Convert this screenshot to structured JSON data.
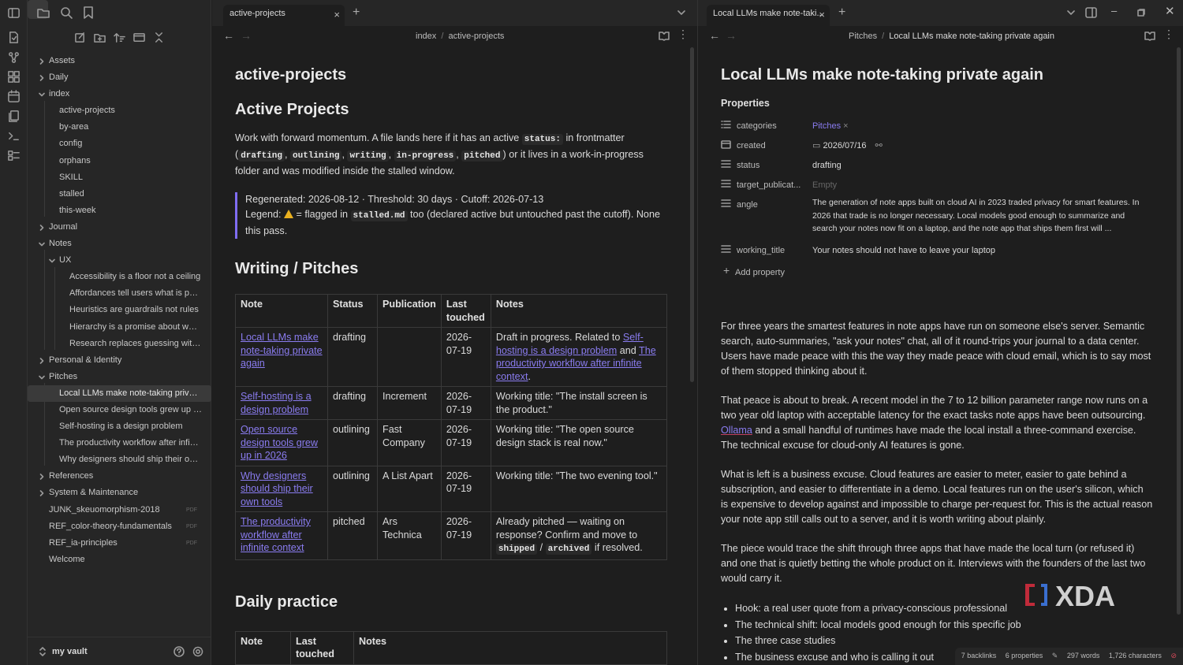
{
  "sidebar": {
    "tree": [
      {
        "label": "Assets",
        "type": "folder",
        "level": 0,
        "open": false
      },
      {
        "label": "Daily",
        "type": "folder",
        "level": 0,
        "open": false
      },
      {
        "label": "index",
        "type": "folder",
        "level": 0,
        "open": true
      },
      {
        "label": "active-projects",
        "type": "file",
        "level": 1
      },
      {
        "label": "by-area",
        "type": "file",
        "level": 1
      },
      {
        "label": "config",
        "type": "file",
        "level": 1
      },
      {
        "label": "orphans",
        "type": "file",
        "level": 1
      },
      {
        "label": "SKILL",
        "type": "file",
        "level": 1
      },
      {
        "label": "stalled",
        "type": "file",
        "level": 1
      },
      {
        "label": "this-week",
        "type": "file",
        "level": 1
      },
      {
        "label": "Journal",
        "type": "folder",
        "level": 0,
        "open": false
      },
      {
        "label": "Notes",
        "type": "folder",
        "level": 0,
        "open": true
      },
      {
        "label": "UX",
        "type": "folder",
        "level": 1,
        "open": true
      },
      {
        "label": "Accessibility is a floor not a ceiling",
        "type": "file",
        "level": 2
      },
      {
        "label": "Affordances tell users what is possi...",
        "type": "file",
        "level": 2
      },
      {
        "label": "Heuristics are guardrails not rules",
        "type": "file",
        "level": 2
      },
      {
        "label": "Hierarchy is a promise about what ...",
        "type": "file",
        "level": 2
      },
      {
        "label": "Research replaces guessing with wi...",
        "type": "file",
        "level": 2
      },
      {
        "label": "Personal & Identity",
        "type": "folder",
        "level": 0,
        "open": false
      },
      {
        "label": "Pitches",
        "type": "folder",
        "level": 0,
        "open": true
      },
      {
        "label": "Local LLMs make note-taking private ...",
        "type": "file",
        "level": 1,
        "active": true
      },
      {
        "label": "Open source design tools grew up in ...",
        "type": "file",
        "level": 1
      },
      {
        "label": "Self-hosting is a design problem",
        "type": "file",
        "level": 1
      },
      {
        "label": "The productivity workflow after infinit...",
        "type": "file",
        "level": 1
      },
      {
        "label": "Why designers should ship their own ...",
        "type": "file",
        "level": 1
      },
      {
        "label": "References",
        "type": "folder",
        "level": 0,
        "open": false
      },
      {
        "label": "System & Maintenance",
        "type": "folder",
        "level": 0,
        "open": false
      },
      {
        "label": "JUNK_skeuomorphism-2018",
        "type": "file",
        "level": 0,
        "badge": "PDF"
      },
      {
        "label": "REF_color-theory-fundamentals",
        "type": "file",
        "level": 0,
        "badge": "PDF"
      },
      {
        "label": "REF_ia-principles",
        "type": "file",
        "level": 0,
        "badge": "PDF"
      },
      {
        "label": "Welcome",
        "type": "file",
        "level": 0
      }
    ],
    "vault_name": "my vault"
  },
  "left": {
    "tab_label": "active-projects",
    "crumb_parent": "index",
    "crumb_sep": "/",
    "crumb_current": "active-projects",
    "h1": "active-projects",
    "h_active": "Active Projects",
    "intro": {
      "t1": "Work with forward momentum. A file lands here if it has an active ",
      "code_status": "status:",
      "t2": " in frontmatter (",
      "c_drafting": "drafting",
      "c_outlining": "outlining",
      "c_writing": "writing",
      "c_inprogress": "in-progress",
      "c_pitched": "pitched",
      "comma": ",",
      "t3": ") or it lives in a work-in-progress folder and was modified inside the stalled window."
    },
    "quote": {
      "line1": "Regenerated: 2026-08-12 · Threshold: 30 days · Cutoff: 2026-07-13",
      "legend_pre": "Legend: ",
      "legend_mid": " = flagged in ",
      "legend_code": "stalled.md",
      "legend_post": " too (declared active but untouched past the cutoff). None this pass."
    },
    "h_writing": "Writing / Pitches",
    "table_headers": [
      "Note",
      "Status",
      "Publication",
      "Last touched",
      "Notes"
    ],
    "rows": [
      {
        "note": "Local LLMs make note-taking private again",
        "status": "drafting",
        "pub": "",
        "date": "2026-07-19"
      },
      {
        "note": "Self-hosting is a design problem",
        "status": "drafting",
        "pub": "Increment",
        "date": "2026-07-19",
        "notes": "Working title: \"The install screen is the product.\""
      },
      {
        "note": "Open source design tools grew up in 2026",
        "status": "outlining",
        "pub": "Fast Company",
        "date": "2026-07-19",
        "notes": "Working title: \"The open source design stack is real now.\""
      },
      {
        "note": "Why designers should ship their own tools",
        "status": "outlining",
        "pub": "A List Apart",
        "date": "2026-07-19",
        "notes": "Working title: \"The two evening tool.\""
      },
      {
        "note": "The productivity workflow after infinite context",
        "status": "pitched",
        "pub": "Ars Technica",
        "date": "2026-07-19"
      }
    ],
    "row1_notes": {
      "t1": "Draft in progress. Related to ",
      "l1": "Self-hosting is a design problem",
      "t2": " and ",
      "l2": "The productivity workflow after infinite context",
      "t3": "."
    },
    "row5_notes": {
      "t1": "Already pitched — waiting on response? Confirm and move to ",
      "c1": "shipped",
      "sep": " / ",
      "c2": "archived",
      "t2": " if resolved."
    },
    "h_daily": "Daily practice",
    "daily_headers": [
      "Note",
      "Last touched",
      "Notes"
    ]
  },
  "right": {
    "tab_label": "Local LLMs make note-taki...",
    "crumb_parent": "Pitches",
    "crumb_sep": "/",
    "crumb_current": "Local LLMs make note-taking private again",
    "title": "Local LLMs make note-taking private again",
    "properties_label": "Properties",
    "props": {
      "categories_key": "categories",
      "categories_val": "Pitches",
      "created_key": "created",
      "created_val": "2026/07/16",
      "status_key": "status",
      "status_val": "drafting",
      "target_key": "target_publicat...",
      "target_val": "Empty",
      "angle_key": "angle",
      "angle_val": "The generation of note apps built on cloud AI in 2023 traded privacy for smart features. In 2026 that trade is no longer necessary. Local models good enough to summarize and search your notes now fit on a laptop, and the note app that ships them first will ...",
      "working_key": "working_title",
      "working_val": "Your notes should not have to leave your laptop",
      "add_label": "Add property"
    },
    "p1": "For three years the smartest features in note apps have run on someone else's server. Semantic search, auto-summaries, \"ask your notes\" chat, all of it round-trips your journal to a data center. Users have made peace with this the way they made peace with cloud email, which is to say most of them stopped thinking about it.",
    "p2a": "That peace is about to break. A recent model in the 7 to 12 billion parameter range now runs on a two year old laptop with acceptable latency for the exact tasks note apps have been outsourcing. ",
    "p2_link": "Ollama",
    "p2b": " and a small handful of runtimes have made the local install a three-command exercise. The technical excuse for cloud-only AI features is gone.",
    "p3": "What is left is a business excuse. Cloud features are easier to meter, easier to gate behind a subscription, and easier to differentiate in a demo. Local features run on the user's silicon, which is expensive to develop against and impossible to charge per-request for. This is the actual reason your note app still calls out to a server, and it is worth writing about plainly.",
    "p4": "The piece would trace the shift through three apps that have made the local turn (or refused it) and one that is quietly betting the whole product on it. Interviews with the founders of the last two would carry it.",
    "bullets": [
      "Hook: a real user quote from a privacy-conscious professional",
      "The technical shift: local models good enough for this specific job",
      "The three case studies",
      "The business excuse and who is calling it out"
    ],
    "status_bar": {
      "backlinks": "7 backlinks",
      "properties": "6 properties",
      "words": "297 words",
      "chars": "1,726 characters"
    }
  },
  "colors": {
    "accent": "#7f6df2",
    "link": "#8a7cf0",
    "bg": "#1e1e1e",
    "panel": "#262626",
    "warn": "#e9b01f"
  },
  "watermark": "XDA"
}
